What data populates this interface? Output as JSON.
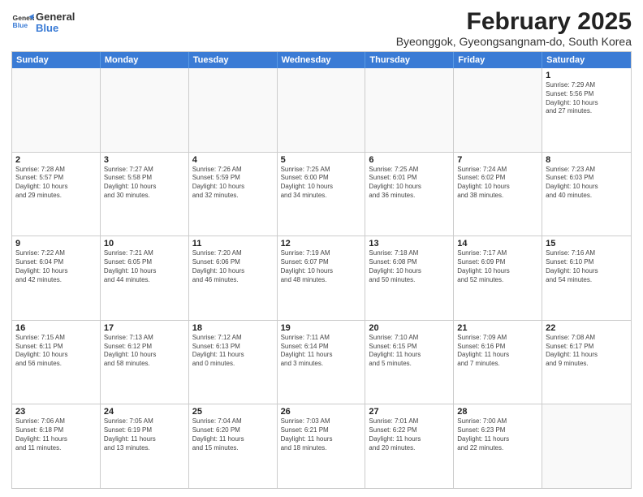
{
  "logo": {
    "line1": "General",
    "line2": "Blue"
  },
  "title": "February 2025",
  "subtitle": "Byeonggok, Gyeongsangnam-do, South Korea",
  "header_days": [
    "Sunday",
    "Monday",
    "Tuesday",
    "Wednesday",
    "Thursday",
    "Friday",
    "Saturday"
  ],
  "weeks": [
    [
      {
        "day": "",
        "text": "",
        "empty": true
      },
      {
        "day": "",
        "text": "",
        "empty": true
      },
      {
        "day": "",
        "text": "",
        "empty": true
      },
      {
        "day": "",
        "text": "",
        "empty": true
      },
      {
        "day": "",
        "text": "",
        "empty": true
      },
      {
        "day": "",
        "text": "",
        "empty": true
      },
      {
        "day": "1",
        "text": "Sunrise: 7:29 AM\nSunset: 5:56 PM\nDaylight: 10 hours\nand 27 minutes."
      }
    ],
    [
      {
        "day": "2",
        "text": "Sunrise: 7:28 AM\nSunset: 5:57 PM\nDaylight: 10 hours\nand 29 minutes."
      },
      {
        "day": "3",
        "text": "Sunrise: 7:27 AM\nSunset: 5:58 PM\nDaylight: 10 hours\nand 30 minutes."
      },
      {
        "day": "4",
        "text": "Sunrise: 7:26 AM\nSunset: 5:59 PM\nDaylight: 10 hours\nand 32 minutes."
      },
      {
        "day": "5",
        "text": "Sunrise: 7:25 AM\nSunset: 6:00 PM\nDaylight: 10 hours\nand 34 minutes."
      },
      {
        "day": "6",
        "text": "Sunrise: 7:25 AM\nSunset: 6:01 PM\nDaylight: 10 hours\nand 36 minutes."
      },
      {
        "day": "7",
        "text": "Sunrise: 7:24 AM\nSunset: 6:02 PM\nDaylight: 10 hours\nand 38 minutes."
      },
      {
        "day": "8",
        "text": "Sunrise: 7:23 AM\nSunset: 6:03 PM\nDaylight: 10 hours\nand 40 minutes."
      }
    ],
    [
      {
        "day": "9",
        "text": "Sunrise: 7:22 AM\nSunset: 6:04 PM\nDaylight: 10 hours\nand 42 minutes."
      },
      {
        "day": "10",
        "text": "Sunrise: 7:21 AM\nSunset: 6:05 PM\nDaylight: 10 hours\nand 44 minutes."
      },
      {
        "day": "11",
        "text": "Sunrise: 7:20 AM\nSunset: 6:06 PM\nDaylight: 10 hours\nand 46 minutes."
      },
      {
        "day": "12",
        "text": "Sunrise: 7:19 AM\nSunset: 6:07 PM\nDaylight: 10 hours\nand 48 minutes."
      },
      {
        "day": "13",
        "text": "Sunrise: 7:18 AM\nSunset: 6:08 PM\nDaylight: 10 hours\nand 50 minutes."
      },
      {
        "day": "14",
        "text": "Sunrise: 7:17 AM\nSunset: 6:09 PM\nDaylight: 10 hours\nand 52 minutes."
      },
      {
        "day": "15",
        "text": "Sunrise: 7:16 AM\nSunset: 6:10 PM\nDaylight: 10 hours\nand 54 minutes."
      }
    ],
    [
      {
        "day": "16",
        "text": "Sunrise: 7:15 AM\nSunset: 6:11 PM\nDaylight: 10 hours\nand 56 minutes."
      },
      {
        "day": "17",
        "text": "Sunrise: 7:13 AM\nSunset: 6:12 PM\nDaylight: 10 hours\nand 58 minutes."
      },
      {
        "day": "18",
        "text": "Sunrise: 7:12 AM\nSunset: 6:13 PM\nDaylight: 11 hours\nand 0 minutes."
      },
      {
        "day": "19",
        "text": "Sunrise: 7:11 AM\nSunset: 6:14 PM\nDaylight: 11 hours\nand 3 minutes."
      },
      {
        "day": "20",
        "text": "Sunrise: 7:10 AM\nSunset: 6:15 PM\nDaylight: 11 hours\nand 5 minutes."
      },
      {
        "day": "21",
        "text": "Sunrise: 7:09 AM\nSunset: 6:16 PM\nDaylight: 11 hours\nand 7 minutes."
      },
      {
        "day": "22",
        "text": "Sunrise: 7:08 AM\nSunset: 6:17 PM\nDaylight: 11 hours\nand 9 minutes."
      }
    ],
    [
      {
        "day": "23",
        "text": "Sunrise: 7:06 AM\nSunset: 6:18 PM\nDaylight: 11 hours\nand 11 minutes."
      },
      {
        "day": "24",
        "text": "Sunrise: 7:05 AM\nSunset: 6:19 PM\nDaylight: 11 hours\nand 13 minutes."
      },
      {
        "day": "25",
        "text": "Sunrise: 7:04 AM\nSunset: 6:20 PM\nDaylight: 11 hours\nand 15 minutes."
      },
      {
        "day": "26",
        "text": "Sunrise: 7:03 AM\nSunset: 6:21 PM\nDaylight: 11 hours\nand 18 minutes."
      },
      {
        "day": "27",
        "text": "Sunrise: 7:01 AM\nSunset: 6:22 PM\nDaylight: 11 hours\nand 20 minutes."
      },
      {
        "day": "28",
        "text": "Sunrise: 7:00 AM\nSunset: 6:23 PM\nDaylight: 11 hours\nand 22 minutes."
      },
      {
        "day": "",
        "text": "",
        "empty": true
      }
    ]
  ]
}
